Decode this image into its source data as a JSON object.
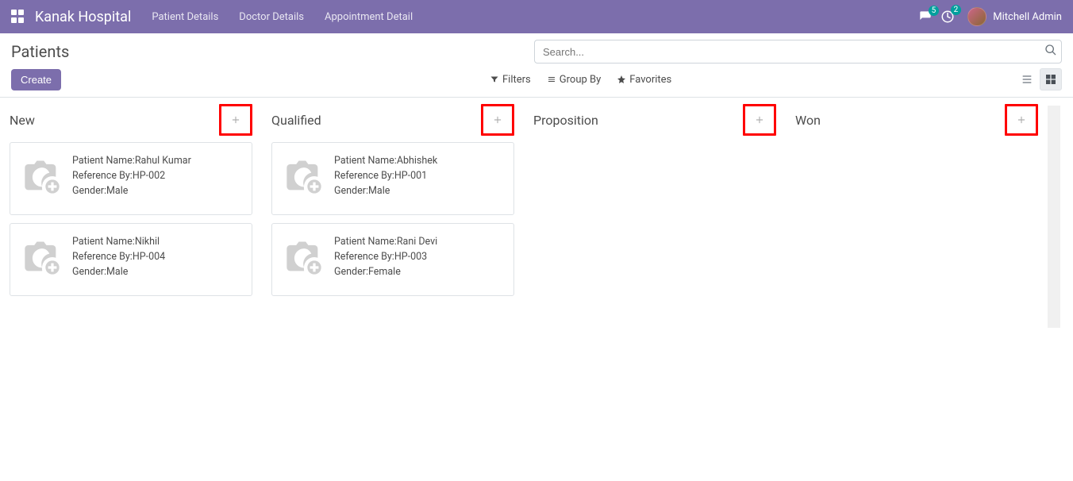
{
  "nav": {
    "brand": "Kanak Hospital",
    "links": [
      "Patient Details",
      "Doctor Details",
      "Appointment Detail"
    ],
    "msg_count": "5",
    "activity_count": "2",
    "user_name": "Mitchell Admin"
  },
  "cp": {
    "title": "Patients",
    "search_placeholder": "Search...",
    "create_label": "Create",
    "filters_label": "Filters",
    "groupby_label": "Group By",
    "favorites_label": "Favorites"
  },
  "field_labels": {
    "name": "Patient Name:",
    "ref": "Reference By:",
    "gender": "Gender:"
  },
  "columns": [
    {
      "title": "New",
      "cards": [
        {
          "name": "Rahul Kumar",
          "ref": "HP-002",
          "gender": "Male"
        },
        {
          "name": "Nikhil",
          "ref": "HP-004",
          "gender": "Male"
        }
      ]
    },
    {
      "title": "Qualified",
      "cards": [
        {
          "name": "Abhishek",
          "ref": "HP-001",
          "gender": "Male"
        },
        {
          "name": "Rani Devi",
          "ref": "HP-003",
          "gender": "Female"
        }
      ]
    },
    {
      "title": "Proposition",
      "cards": []
    },
    {
      "title": "Won",
      "cards": []
    }
  ]
}
